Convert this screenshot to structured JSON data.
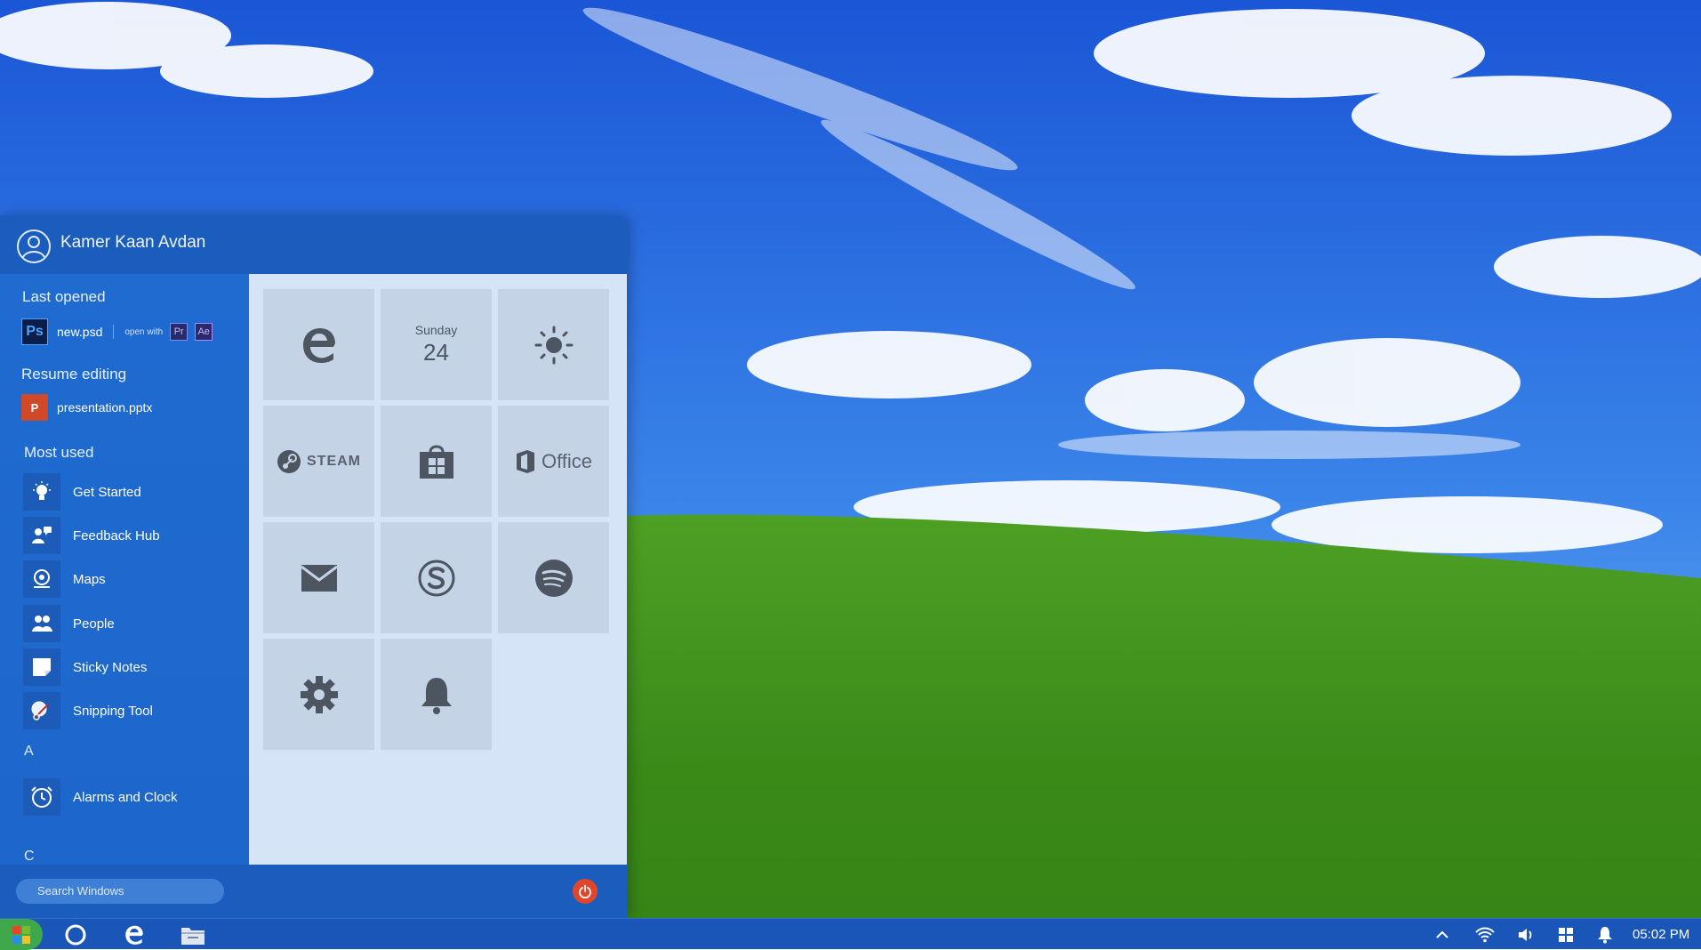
{
  "user": {
    "name": "Kamer Kaan Avdan"
  },
  "sections": {
    "last_opened": "Last opened",
    "resume_editing": "Resume editing",
    "most_used": "Most used"
  },
  "last_opened": {
    "file": "new.psd",
    "badge": "Ps",
    "open_with_label": "open with",
    "open_with_apps": [
      "Pr",
      "Ae"
    ]
  },
  "resume_editing": {
    "file": "presentation.pptx",
    "badge": "P"
  },
  "most_used": [
    {
      "label": "Get Started",
      "icon": "lightbulb-icon"
    },
    {
      "label": "Feedback Hub",
      "icon": "feedback-icon"
    },
    {
      "label": "Maps",
      "icon": "maps-icon"
    },
    {
      "label": "People",
      "icon": "people-icon"
    },
    {
      "label": "Sticky Notes",
      "icon": "sticky-notes-icon"
    },
    {
      "label": "Snipping Tool",
      "icon": "snipping-tool-icon"
    }
  ],
  "letters": [
    "A",
    "C"
  ],
  "alphabetical": [
    {
      "label": "Alarms and Clock",
      "icon": "alarm-clock-icon"
    }
  ],
  "tiles": {
    "calendar": {
      "day": "Sunday",
      "date": "24"
    },
    "steam": "STEAM",
    "office": "Office"
  },
  "search": {
    "placeholder": "Search Windows"
  },
  "taskbar": {
    "time": "05:02 PM"
  },
  "colors": {
    "menu_blue": "#1a5fbf",
    "tile_bg": "#c5d3e6",
    "tiles_area": "#d6e4f7",
    "power": "#e0472a",
    "start_green": "#3ea84a"
  }
}
